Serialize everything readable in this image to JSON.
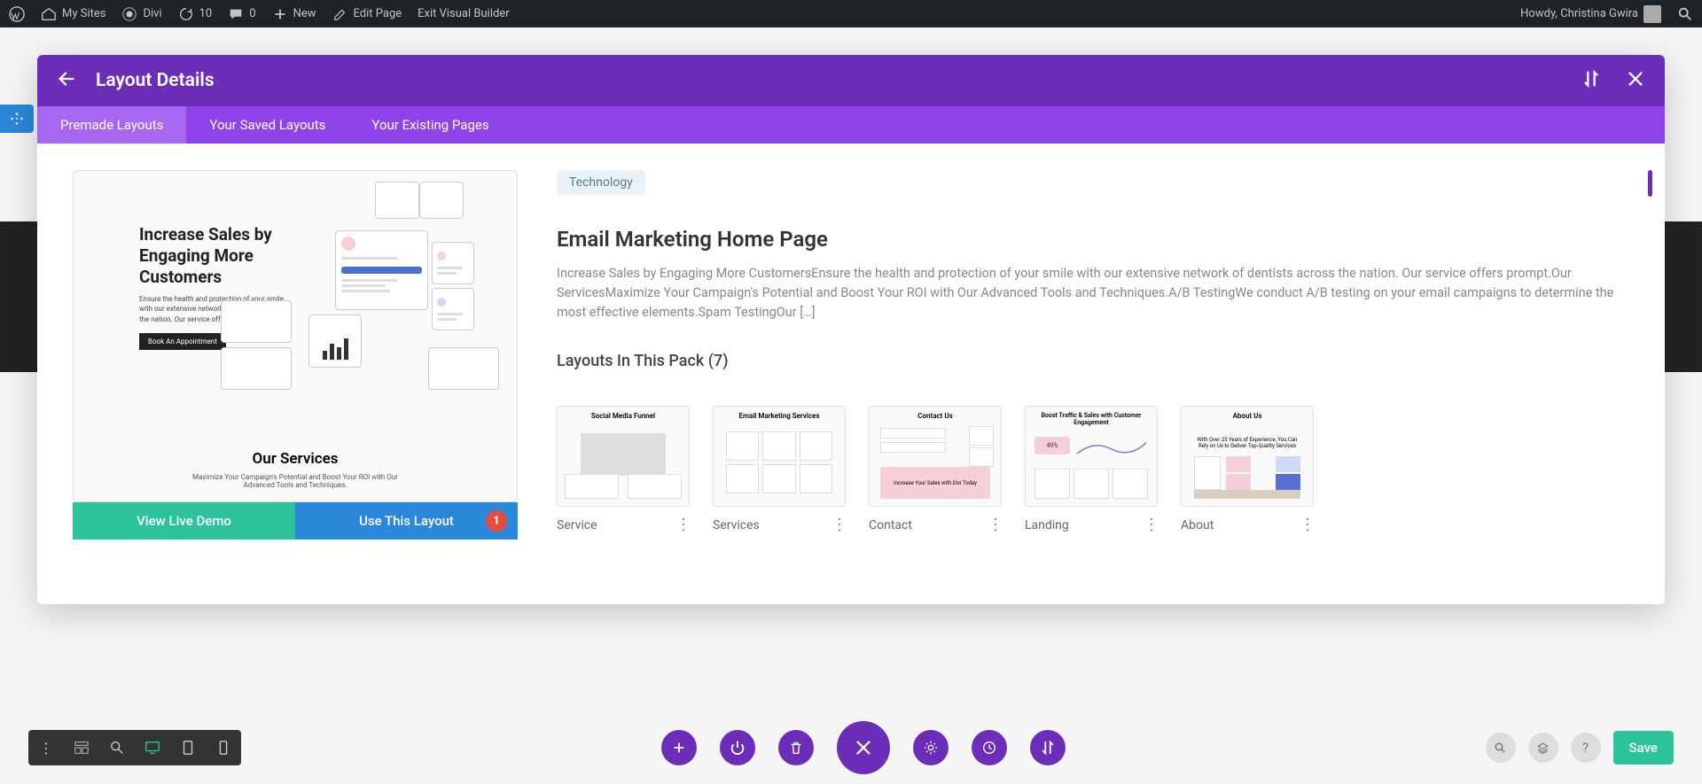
{
  "adminbar": {
    "mysites": "My Sites",
    "site": "Divi",
    "updates": "10",
    "comments": "0",
    "new": "New",
    "edit": "Edit Page",
    "exit": "Exit Visual Builder",
    "howdy": "Howdy, Christina Gwira"
  },
  "modal": {
    "title": "Layout Details",
    "tabs": {
      "premade": "Premade Layouts",
      "saved": "Your Saved Layouts",
      "existing": "Your Existing Pages"
    },
    "preview": {
      "headline": "Increase Sales by Engaging More Customers",
      "body": "Ensure the health and protection of your smile with our extensive network of dentists across the nation. Our service offers prompt.",
      "cta": "Book An Appointment",
      "services_title": "Our Services",
      "services_sub": "Maximize Your Campaign's Potential and Boost Your ROI with Our Advanced Tools and Techniques."
    },
    "actions": {
      "demo": "View Live Demo",
      "use": "Use This Layout",
      "badge": "1"
    },
    "tag": "Technology",
    "layout_title": "Email Marketing Home Page",
    "desc": "Increase Sales by Engaging More CustomersEnsure the health and protection of your smile with our extensive network of dentists across the nation. Our service offers prompt.Our ServicesMaximize Your Campaign's Potential and Boost Your ROI with Our Advanced Tools and Techniques.A/B TestingWe conduct A/B testing on your email campaigns to determine the most effective elements.Spam TestingOur […]",
    "pack_title": "Layouts In This Pack (7)",
    "thumbs": [
      {
        "caption": "Service",
        "title": "Social Media Funnel"
      },
      {
        "caption": "Services",
        "title": "Email Marketing Services"
      },
      {
        "caption": "Contact",
        "title": "Contact Us"
      },
      {
        "caption": "Landing",
        "title": "Boost Traffic & Sales with Customer Engagement"
      },
      {
        "caption": "About",
        "title": "About Us"
      }
    ]
  },
  "bottom": {
    "save": "Save"
  }
}
